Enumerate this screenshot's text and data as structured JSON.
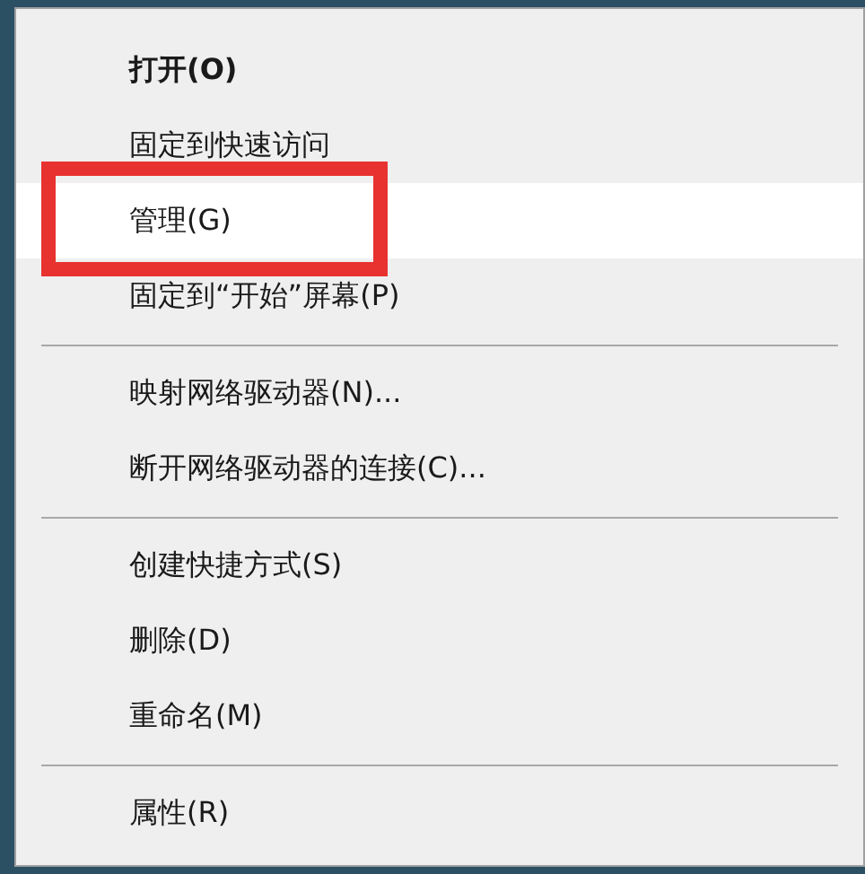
{
  "context_menu": {
    "items": [
      {
        "kind": "item",
        "label": "打开(O)",
        "default": true,
        "selected": false,
        "annotated": false
      },
      {
        "kind": "item",
        "label": "固定到快速访问",
        "default": false,
        "selected": false,
        "annotated": false
      },
      {
        "kind": "item",
        "label": "管理(G)",
        "default": false,
        "selected": true,
        "annotated": true
      },
      {
        "kind": "item",
        "label": "固定到“开始”屏幕(P)",
        "default": false,
        "selected": false,
        "annotated": false
      },
      {
        "kind": "separator"
      },
      {
        "kind": "item",
        "label": "映射网络驱动器(N)...",
        "default": false,
        "selected": false,
        "annotated": false
      },
      {
        "kind": "item",
        "label": "断开网络驱动器的连接(C)...",
        "default": false,
        "selected": false,
        "annotated": false
      },
      {
        "kind": "separator"
      },
      {
        "kind": "item",
        "label": "创建快捷方式(S)",
        "default": false,
        "selected": false,
        "annotated": false
      },
      {
        "kind": "item",
        "label": "删除(D)",
        "default": false,
        "selected": false,
        "annotated": false
      },
      {
        "kind": "item",
        "label": "重命名(M)",
        "default": false,
        "selected": false,
        "annotated": false
      },
      {
        "kind": "separator"
      },
      {
        "kind": "item",
        "label": "属性(R)",
        "default": false,
        "selected": false,
        "annotated": false
      }
    ]
  }
}
